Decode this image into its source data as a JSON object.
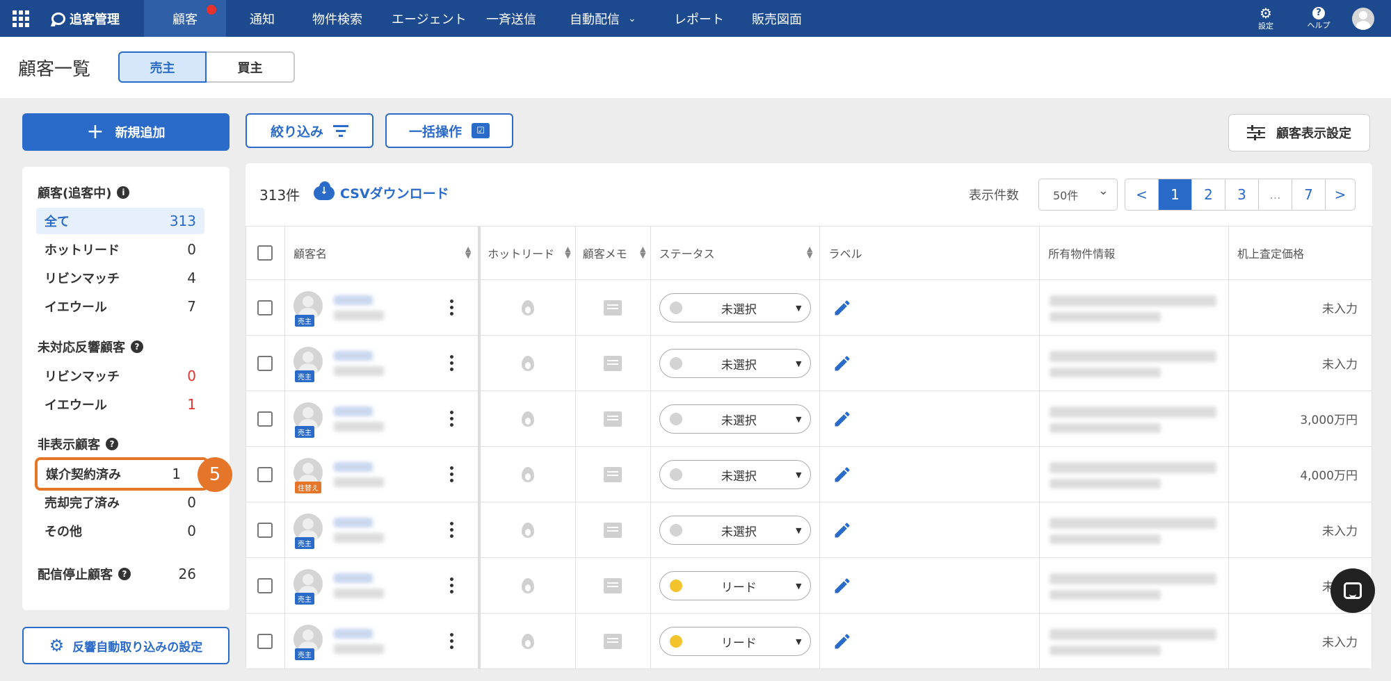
{
  "nav": {
    "brand": "追客管理",
    "items": [
      "顧客",
      "通知",
      "物件検索",
      "エージェント",
      "一斉送信",
      "自動配信",
      "レポート",
      "販売図面"
    ],
    "settings_label": "設定",
    "help_label": "ヘルプ",
    "help_glyph": "?"
  },
  "header": {
    "title": "顧客一覧",
    "tab_seller": "売主",
    "tab_buyer": "買主"
  },
  "toolbar": {
    "new_label": "新規追加",
    "filter_label": "絞り込み",
    "bulk_label": "一括操作",
    "display_settings_label": "顧客表示設定"
  },
  "sidebar": {
    "section_tracking": "顧客(追客中)",
    "section_tracking_info": "i",
    "tracking": [
      {
        "label": "全て",
        "count": "313"
      },
      {
        "label": "ホットリード",
        "count": "0"
      },
      {
        "label": "リビンマッチ",
        "count": "4"
      },
      {
        "label": "イエウール",
        "count": "7"
      }
    ],
    "section_unresponded": "未対応反響顧客",
    "section_unresponded_info": "?",
    "unresponded": [
      {
        "label": "リビンマッチ",
        "count": "0"
      },
      {
        "label": "イエウール",
        "count": "1"
      }
    ],
    "section_hidden": "非表示顧客",
    "section_hidden_info": "?",
    "hidden": [
      {
        "label": "媒介契約済み",
        "count": "1"
      },
      {
        "label": "売却完了済み",
        "count": "0"
      },
      {
        "label": "その他",
        "count": "0"
      }
    ],
    "stopped_label": "配信停止顧客",
    "stopped_info": "?",
    "stopped_count": "26",
    "step_badge": "5",
    "auto_import_label": "反響自動取り込みの設定"
  },
  "list": {
    "count": "313件",
    "csv_label": "CSVダウンロード",
    "per_page_label": "表示件数",
    "per_page_value": "50件",
    "pager": [
      "<",
      "1",
      "2",
      "3",
      "…",
      "7",
      ">"
    ],
    "current_page": "1",
    "columns": [
      "顧客名",
      "ホットリード",
      "顧客メモ",
      "ステータス",
      "ラベル",
      "所有物件情報",
      "机上査定価格"
    ],
    "rows": [
      {
        "tag": "売主",
        "tag_color": "#2a6bc9",
        "status": "未選択",
        "status_color": "#d3d3d3",
        "price": "未入力"
      },
      {
        "tag": "売主",
        "tag_color": "#2a6bc9",
        "status": "未選択",
        "status_color": "#d3d3d3",
        "price": "未入力"
      },
      {
        "tag": "売主",
        "tag_color": "#2a6bc9",
        "status": "未選択",
        "status_color": "#d3d3d3",
        "price": "3,000万円"
      },
      {
        "tag": "住替え",
        "tag_color": "#e57529",
        "status": "未選択",
        "status_color": "#d3d3d3",
        "price": "4,000万円"
      },
      {
        "tag": "売主",
        "tag_color": "#2a6bc9",
        "status": "未選択",
        "status_color": "#d3d3d3",
        "price": "未入力"
      },
      {
        "tag": "売主",
        "tag_color": "#2a6bc9",
        "status": "リード",
        "status_color": "#f3c32d",
        "price": "未入力"
      },
      {
        "tag": "売主",
        "tag_color": "#2a6bc9",
        "status": "リード",
        "status_color": "#f3c32d",
        "price": "未入力"
      }
    ]
  },
  "colors": {
    "nav_bg": "#1d4a8f",
    "accent": "#2a6bc9",
    "highlight": "#e57529",
    "alert": "#e5322d"
  }
}
